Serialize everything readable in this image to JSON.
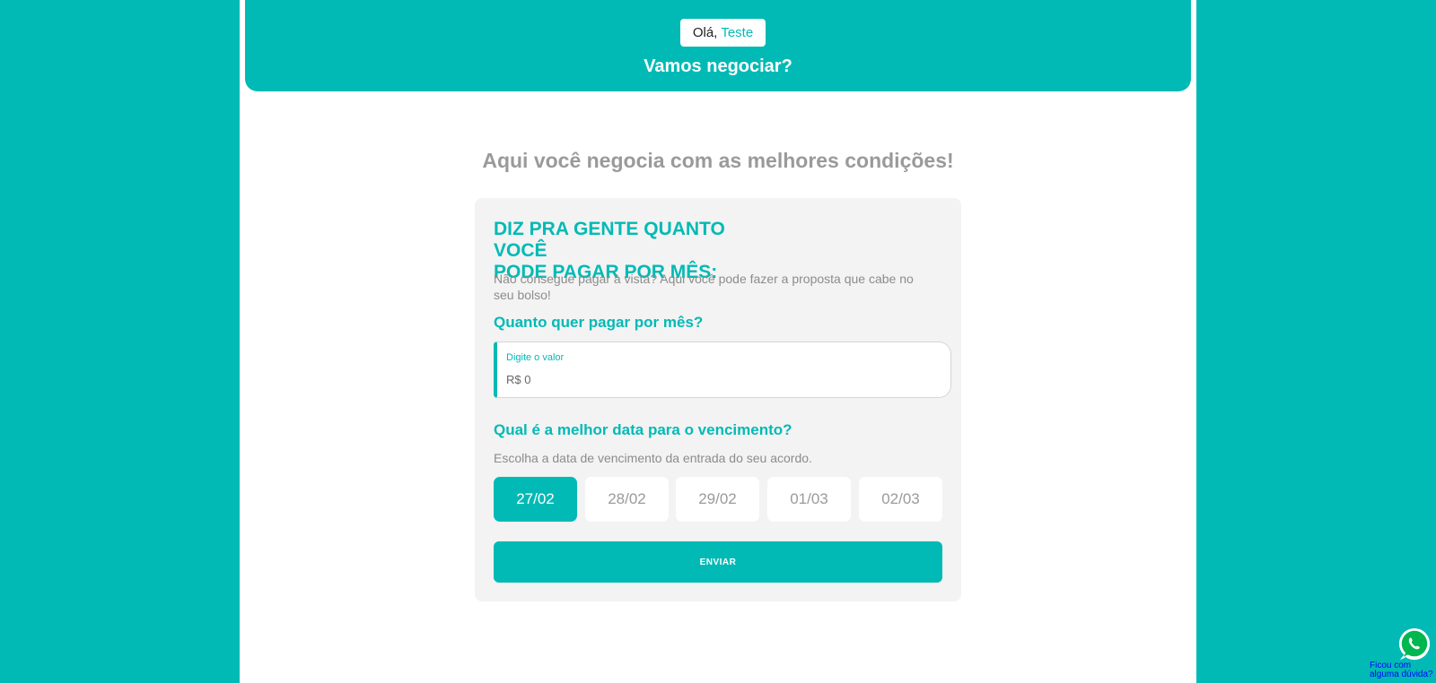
{
  "banner": {
    "greeting_prefix": "Olá,",
    "greeting_name": "Teste",
    "title": "Vamos negociar?"
  },
  "headline": "Aqui você negocia com as melhores condições!",
  "card": {
    "title_line1": "DIZ PRA GENTE QUANTO VOCÊ",
    "title_line2": "PODE PAGAR POR MÊS:",
    "description": "Não consegue pagar à vista? Aqui você pode fazer a proposta que cabe no seu bolso!",
    "amount_question": "Quanto quer pagar por mês?",
    "amount_label": "Digite o valor",
    "amount_value": "R$ 0",
    "date_question": "Qual é a melhor data para o vencimento?",
    "date_description": "Escolha a data de vencimento da entrada do seu acordo.",
    "dates": [
      "27/02",
      "28/02",
      "29/02",
      "01/03",
      "02/03"
    ],
    "selected_date": "27/02",
    "submit_label": "ENVIAR"
  },
  "whatsapp": {
    "icon": "whatsapp-icon",
    "label": "Ficou com alguma dúvida?"
  },
  "colors": {
    "brand": "#02bab5",
    "card_background": "#f3f3f3",
    "muted_text": "#9a9a9a"
  }
}
